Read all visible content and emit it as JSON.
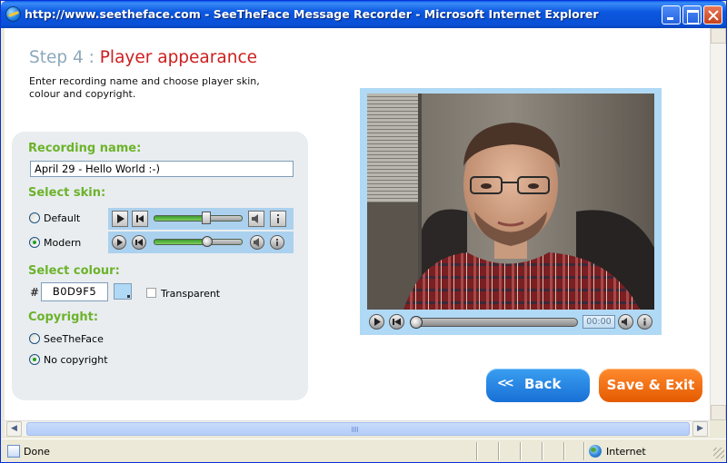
{
  "window": {
    "title": "http://www.seetheface.com - SeeTheFace Message Recorder - Microsoft Internet Explorer"
  },
  "page": {
    "step_number": "Step 4 : ",
    "step_name": "Player appearance",
    "instructions": "Enter recording name and choose player skin, colour and copyright."
  },
  "form": {
    "recording_name_label": "Recording name:",
    "recording_name_value": "April 29 - Hello World :-)",
    "skin_label": "Select skin:",
    "skin_options": [
      {
        "label": "Default",
        "selected": false
      },
      {
        "label": "Modern",
        "selected": true
      }
    ],
    "colour_label": "Select colour:",
    "colour_prefix": "#",
    "colour_value": "B0D9F5",
    "transparent_label": "Transparent",
    "transparent_checked": false,
    "copyright_label": "Copyright:",
    "copyright_options": [
      {
        "label": "SeeTheFace",
        "selected": false
      },
      {
        "label": "No copyright",
        "selected": true
      }
    ]
  },
  "player": {
    "time": "00:00",
    "progress": 0,
    "icons": [
      "play-icon",
      "rewind-icon",
      "volume-icon",
      "info-icon"
    ]
  },
  "buttons": {
    "back_icon": "<<",
    "back_label": "Back",
    "save_label": "Save & Exit"
  },
  "statusbar": {
    "status": "Done",
    "zone": "Internet"
  },
  "colors": {
    "title_bar": "#0a55e0",
    "step_number": "#8ca8bc",
    "step_name": "#cc1e1e",
    "section_labels": "#6cb32a",
    "skin_colour": "#B0D9F5",
    "back_button": "#1f7fe0",
    "save_button": "#f26d10"
  }
}
